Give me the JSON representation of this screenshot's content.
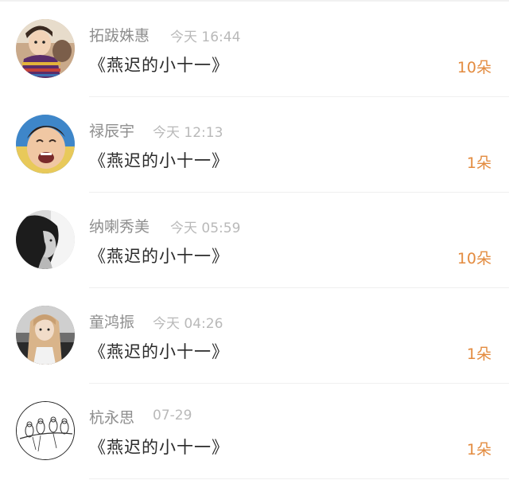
{
  "gift_list": [
    {
      "name": "拓跋姝惠",
      "time": "今天 16:44",
      "title": "《燕迟的小十一》",
      "amount": "10朵",
      "avatar": "child-in-striped-sweater-avatar"
    },
    {
      "name": "禄辰宇",
      "time": "今天 12:13",
      "title": "《燕迟的小十一》",
      "amount": "1朵",
      "avatar": "laughing-child-avatar"
    },
    {
      "name": "纳喇秀美",
      "time": "今天 05:59",
      "title": "《燕迟的小十一》",
      "amount": "10朵",
      "avatar": "woman-profile-bw-avatar"
    },
    {
      "name": "童鸿振",
      "time": "今天 04:26",
      "title": "《燕迟的小十一》",
      "amount": "1朵",
      "avatar": "long-hair-girl-avatar"
    },
    {
      "name": "杭永思",
      "time": "07-29",
      "title": "《燕迟的小十一》",
      "amount": "1朵",
      "avatar": "birds-on-branch-sketch-avatar"
    }
  ],
  "colors": {
    "name": "#8e8e8e",
    "time": "#b9b9b9",
    "title": "#2a2a2a",
    "amount": "#e38b3f"
  }
}
